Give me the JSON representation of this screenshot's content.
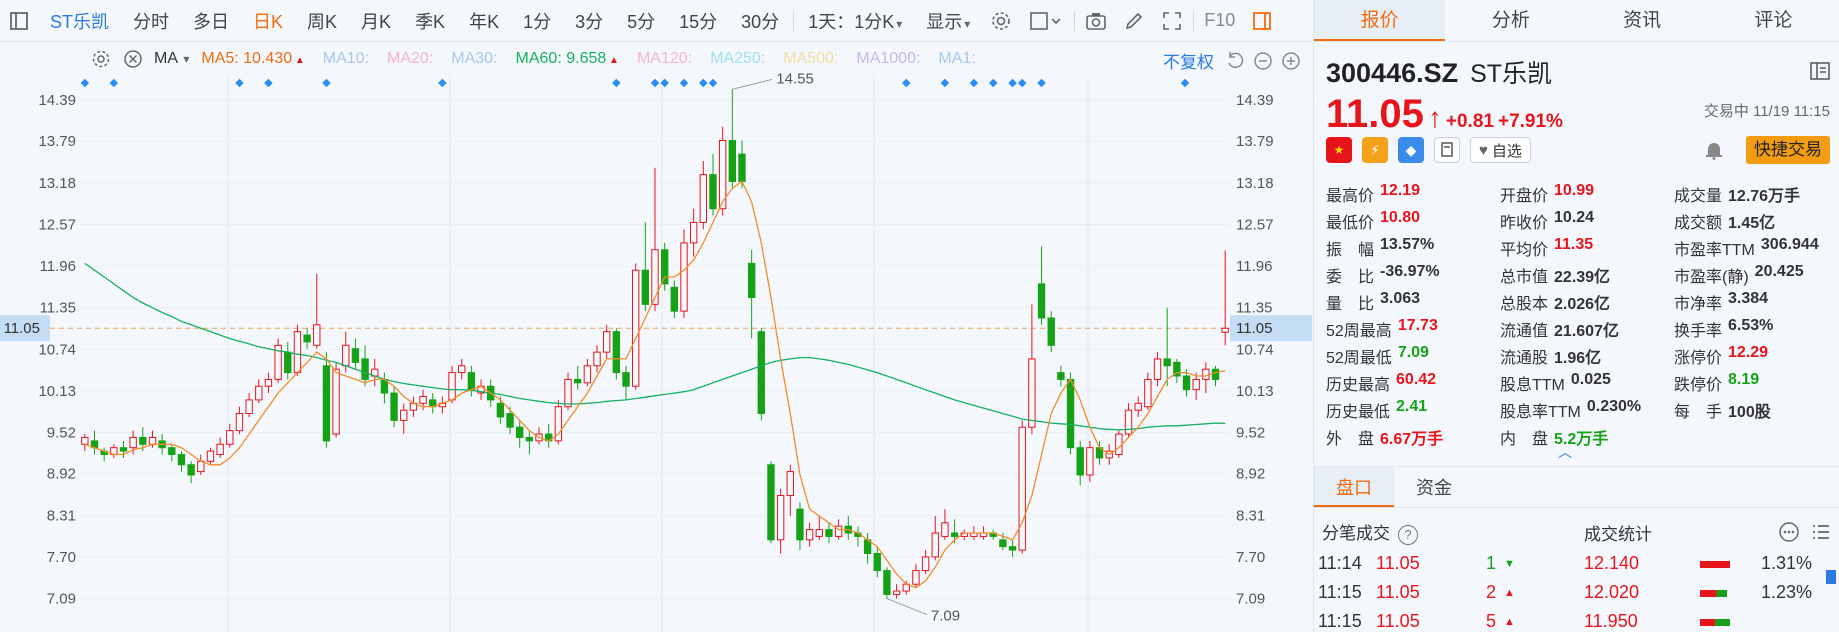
{
  "toolbar": {
    "stock_name": "ST乐凯",
    "periods": [
      "分时",
      "多日",
      "日K",
      "周K",
      "月K",
      "季K",
      "年K",
      "1分",
      "3分",
      "5分",
      "15分",
      "30分"
    ],
    "active_period": "日K",
    "interval_select": "1天：1分K",
    "display_select": "显示",
    "f10_label": "F10"
  },
  "ma_bar": {
    "indicator": "MA",
    "items": [
      {
        "label": "MA5: 10.430",
        "color": "#f26b10",
        "arrow": "up"
      },
      {
        "label": "MA10:",
        "color": "#a6c8ee"
      },
      {
        "label": "MA20:",
        "color": "#f4b6c6"
      },
      {
        "label": "MA30:",
        "color": "#a6c8ee"
      },
      {
        "label": "MA60: 9.658",
        "color": "#16b060",
        "arrow": "up"
      },
      {
        "label": "MA120:",
        "color": "#f4b6c6"
      },
      {
        "label": "MA250:",
        "color": "#9ee0ee"
      },
      {
        "label": "MA500:",
        "color": "#f3dc9e"
      },
      {
        "label": "MA1000:",
        "color": "#c6b6ee"
      },
      {
        "label": "MA1:",
        "color": "#a6c8ee"
      }
    ],
    "adjust_label": "不复权"
  },
  "chart_data": {
    "type": "candlestick",
    "y_ticks": [
      "14.39",
      "13.79",
      "13.18",
      "12.57",
      "11.96",
      "11.35",
      "10.74",
      "10.13",
      "9.52",
      "8.92",
      "8.31",
      "7.70",
      "7.09"
    ],
    "ylim": [
      6.6,
      14.95
    ],
    "current_price_label": "11.05",
    "current_price": 11.05,
    "max_label": "14.55",
    "min_label": "7.09",
    "candles": [
      [
        9.35,
        9.45,
        9.25,
        9.5
      ],
      [
        9.4,
        9.3,
        9.2,
        9.55
      ],
      [
        9.25,
        9.2,
        9.1,
        9.3
      ],
      [
        9.2,
        9.3,
        9.15,
        9.35
      ],
      [
        9.3,
        9.25,
        9.15,
        9.4
      ],
      [
        9.3,
        9.45,
        9.2,
        9.55
      ],
      [
        9.45,
        9.35,
        9.25,
        9.6
      ],
      [
        9.35,
        9.45,
        9.3,
        9.55
      ],
      [
        9.4,
        9.3,
        9.2,
        9.5
      ],
      [
        9.3,
        9.2,
        9.1,
        9.35
      ],
      [
        9.2,
        9.05,
        8.95,
        9.25
      ],
      [
        9.05,
        8.9,
        8.78,
        9.1
      ],
      [
        8.95,
        9.1,
        8.9,
        9.2
      ],
      [
        9.1,
        9.25,
        9.05,
        9.3
      ],
      [
        9.2,
        9.35,
        9.15,
        9.45
      ],
      [
        9.35,
        9.55,
        9.3,
        9.65
      ],
      [
        9.55,
        9.8,
        9.5,
        9.9
      ],
      [
        9.8,
        10.0,
        9.75,
        10.1
      ],
      [
        10.0,
        10.2,
        9.95,
        10.3
      ],
      [
        10.2,
        10.3,
        10.1,
        10.4
      ],
      [
        10.3,
        10.8,
        10.25,
        10.9
      ],
      [
        10.7,
        10.4,
        10.3,
        10.85
      ],
      [
        10.4,
        11.0,
        10.35,
        11.1
      ],
      [
        10.95,
        10.85,
        10.75,
        11.05
      ],
      [
        10.8,
        11.1,
        10.75,
        11.85
      ],
      [
        10.5,
        9.4,
        9.3,
        10.7
      ],
      [
        9.5,
        10.45,
        9.45,
        10.55
      ],
      [
        10.5,
        10.8,
        10.4,
        11.0
      ],
      [
        10.75,
        10.55,
        10.45,
        10.9
      ],
      [
        10.6,
        10.3,
        10.2,
        10.8
      ],
      [
        10.35,
        10.45,
        10.2,
        10.6
      ],
      [
        10.3,
        10.1,
        9.95,
        10.4
      ],
      [
        10.1,
        9.7,
        9.6,
        10.2
      ],
      [
        9.7,
        9.85,
        9.5,
        9.95
      ],
      [
        9.85,
        9.95,
        9.75,
        10.05
      ],
      [
        9.95,
        10.05,
        9.85,
        10.15
      ],
      [
        10.0,
        9.9,
        9.8,
        10.1
      ],
      [
        9.9,
        9.95,
        9.8,
        10.05
      ],
      [
        10.0,
        10.4,
        9.95,
        10.5
      ],
      [
        10.4,
        10.5,
        10.3,
        10.6
      ],
      [
        10.4,
        10.15,
        10.05,
        10.5
      ],
      [
        10.1,
        10.2,
        10.0,
        10.3
      ],
      [
        10.2,
        10.0,
        9.9,
        10.3
      ],
      [
        9.95,
        9.75,
        9.65,
        10.05
      ],
      [
        9.8,
        9.6,
        9.5,
        9.9
      ],
      [
        9.6,
        9.45,
        9.3,
        9.7
      ],
      [
        9.45,
        9.4,
        9.2,
        9.55
      ],
      [
        9.4,
        9.5,
        9.35,
        9.6
      ],
      [
        9.5,
        9.4,
        9.3,
        9.65
      ],
      [
        9.4,
        9.9,
        9.35,
        10.0
      ],
      [
        9.9,
        10.3,
        9.85,
        10.4
      ],
      [
        10.3,
        10.25,
        10.15,
        10.5
      ],
      [
        10.25,
        10.5,
        10.2,
        10.6
      ],
      [
        10.5,
        10.7,
        10.4,
        10.8
      ],
      [
        10.7,
        11.0,
        10.6,
        11.1
      ],
      [
        11.0,
        10.4,
        10.3,
        11.05
      ],
      [
        10.4,
        10.2,
        10.0,
        10.5
      ],
      [
        10.2,
        11.9,
        10.15,
        12.0
      ],
      [
        11.9,
        11.4,
        11.3,
        12.6
      ],
      [
        11.4,
        12.2,
        11.3,
        13.4
      ],
      [
        12.2,
        11.7,
        11.6,
        12.3
      ],
      [
        11.65,
        11.3,
        11.2,
        11.75
      ],
      [
        11.3,
        12.3,
        11.2,
        12.5
      ],
      [
        12.3,
        12.6,
        12.1,
        12.8
      ],
      [
        12.6,
        13.3,
        12.5,
        13.5
      ],
      [
        13.3,
        12.8,
        12.7,
        13.6
      ],
      [
        12.8,
        13.8,
        12.7,
        14.0
      ],
      [
        13.8,
        13.2,
        13.1,
        14.55
      ],
      [
        13.6,
        13.2,
        13.1,
        13.8
      ],
      [
        12.0,
        11.5,
        10.9,
        12.2
      ],
      [
        11.0,
        9.8,
        9.7,
        11.05
      ],
      [
        9.05,
        7.95,
        7.9,
        9.1
      ],
      [
        7.95,
        8.6,
        7.75,
        8.7
      ],
      [
        8.6,
        8.95,
        8.3,
        9.05
      ],
      [
        8.4,
        7.95,
        7.8,
        8.5
      ],
      [
        7.95,
        8.1,
        7.85,
        8.2
      ],
      [
        8.0,
        8.1,
        7.95,
        8.3
      ],
      [
        8.1,
        8.0,
        7.9,
        8.2
      ],
      [
        8.0,
        8.15,
        7.95,
        8.25
      ],
      [
        8.15,
        8.05,
        7.95,
        8.3
      ],
      [
        8.05,
        8.0,
        7.85,
        8.15
      ],
      [
        7.95,
        7.75,
        7.6,
        8.05
      ],
      [
        7.75,
        7.5,
        7.4,
        7.85
      ],
      [
        7.5,
        7.15,
        7.09,
        7.55
      ],
      [
        7.15,
        7.2,
        7.09,
        7.3
      ],
      [
        7.2,
        7.3,
        7.15,
        7.35
      ],
      [
        7.3,
        7.5,
        7.25,
        7.6
      ],
      [
        7.5,
        7.7,
        7.45,
        7.8
      ],
      [
        7.7,
        8.05,
        7.65,
        8.3
      ],
      [
        8.0,
        8.2,
        7.95,
        8.4
      ],
      [
        8.05,
        8.0,
        7.9,
        8.25
      ],
      [
        8.0,
        8.05,
        7.95,
        8.1
      ],
      [
        8.0,
        8.05,
        7.95,
        8.15
      ],
      [
        8.0,
        8.05,
        7.95,
        8.15
      ],
      [
        8.05,
        8.0,
        7.95,
        8.1
      ],
      [
        7.95,
        7.85,
        7.8,
        8.05
      ],
      [
        7.85,
        7.8,
        7.7,
        7.95
      ],
      [
        7.8,
        9.6,
        7.75,
        9.7
      ],
      [
        9.6,
        10.6,
        9.5,
        11.4
      ],
      [
        11.7,
        11.2,
        11.1,
        12.25
      ],
      [
        11.2,
        10.8,
        10.7,
        11.3
      ],
      [
        10.4,
        10.3,
        10.2,
        10.5
      ],
      [
        10.3,
        9.3,
        9.2,
        10.4
      ],
      [
        9.3,
        8.9,
        8.75,
        9.4
      ],
      [
        8.9,
        9.3,
        8.8,
        9.4
      ],
      [
        9.3,
        9.15,
        9.05,
        9.4
      ],
      [
        9.15,
        9.25,
        9.05,
        9.35
      ],
      [
        9.2,
        9.5,
        9.15,
        9.55
      ],
      [
        9.5,
        9.85,
        9.45,
        9.95
      ],
      [
        9.85,
        9.95,
        9.75,
        10.05
      ],
      [
        9.9,
        10.3,
        9.85,
        10.4
      ],
      [
        10.3,
        10.6,
        10.2,
        10.7
      ],
      [
        10.6,
        10.5,
        10.2,
        11.35
      ],
      [
        10.55,
        10.35,
        10.25,
        10.6
      ],
      [
        10.35,
        10.15,
        10.05,
        10.45
      ],
      [
        10.15,
        10.3,
        10.0,
        10.4
      ],
      [
        10.3,
        10.45,
        10.1,
        10.55
      ],
      [
        10.45,
        10.3,
        10.2,
        10.5
      ],
      [
        10.99,
        11.05,
        10.8,
        12.19
      ]
    ],
    "ma5": [
      9.35,
      9.3,
      9.25,
      9.2,
      9.2,
      9.27,
      9.3,
      9.35,
      9.35,
      9.35,
      9.3,
      9.2,
      9.1,
      9.05,
      9.05,
      9.15,
      9.3,
      9.5,
      9.7,
      9.9,
      10.1,
      10.25,
      10.4,
      10.55,
      10.7,
      10.6,
      10.4,
      10.35,
      10.3,
      10.25,
      10.3,
      10.3,
      10.2,
      10.05,
      9.95,
      9.9,
      9.9,
      9.95,
      10.0,
      10.1,
      10.15,
      10.2,
      10.1,
      10.0,
      9.85,
      9.7,
      9.55,
      9.45,
      9.4,
      9.5,
      9.7,
      9.9,
      10.1,
      10.35,
      10.6,
      10.6,
      10.6,
      10.9,
      11.2,
      11.5,
      11.8,
      11.8,
      11.9,
      12.05,
      12.3,
      12.6,
      12.9,
      13.1,
      13.2,
      12.9,
      12.3,
      11.5,
      10.6,
      9.8,
      8.9,
      8.4,
      8.3,
      8.2,
      8.1,
      8.1,
      8.05,
      7.95,
      7.85,
      7.65,
      7.45,
      7.3,
      7.25,
      7.35,
      7.55,
      7.8,
      7.95,
      8.05,
      8.05,
      8.05,
      8.05,
      8.0,
      7.95,
      8.2,
      8.6,
      9.2,
      9.8,
      10.1,
      10.3,
      10.0,
      9.6,
      9.3,
      9.2,
      9.3,
      9.45,
      9.6,
      9.8,
      10.05,
      10.3,
      10.4,
      10.4,
      10.35,
      10.35,
      10.4,
      10.43
    ],
    "ma60": [
      12.0,
      11.9,
      11.8,
      11.7,
      11.6,
      11.5,
      11.42,
      11.35,
      11.28,
      11.22,
      11.15,
      11.1,
      11.05,
      11.0,
      10.95,
      10.9,
      10.86,
      10.82,
      10.78,
      10.75,
      10.72,
      10.7,
      10.67,
      10.65,
      10.62,
      10.58,
      10.55,
      10.5,
      10.45,
      10.4,
      10.35,
      10.3,
      10.27,
      10.24,
      10.22,
      10.2,
      10.18,
      10.16,
      10.15,
      10.15,
      10.14,
      10.12,
      10.1,
      10.08,
      10.05,
      10.02,
      10.0,
      9.98,
      9.96,
      9.95,
      9.94,
      9.94,
      9.95,
      9.96,
      9.98,
      9.99,
      10.0,
      10.02,
      10.04,
      10.06,
      10.08,
      10.1,
      10.12,
      10.15,
      10.2,
      10.25,
      10.3,
      10.35,
      10.4,
      10.45,
      10.5,
      10.55,
      10.58,
      10.6,
      10.62,
      10.62,
      10.6,
      10.58,
      10.55,
      10.52,
      10.48,
      10.44,
      10.4,
      10.35,
      10.3,
      10.25,
      10.2,
      10.15,
      10.1,
      10.05,
      10.0,
      9.96,
      9.92,
      9.88,
      9.84,
      9.8,
      9.76,
      9.72,
      9.7,
      9.68,
      9.66,
      9.65,
      9.64,
      9.62,
      9.6,
      9.58,
      9.57,
      9.56,
      9.57,
      9.58,
      9.6,
      9.61,
      9.62,
      9.62,
      9.63,
      9.64,
      9.65,
      9.66,
      9.658
    ]
  },
  "right_panel": {
    "tabs": [
      "报价",
      "分析",
      "资讯",
      "评论"
    ],
    "active_tab": "报价",
    "code": "300446.SZ",
    "name": "ST乐凯",
    "price": "11.05",
    "change": "+0.81",
    "change_pct": "+7.91%",
    "trade_status": "交易中 11/19 11:15",
    "fav_label": "自选",
    "quick_trade_label": "快捷交易",
    "stats": [
      [
        {
          "label": "最高价",
          "value": "12.19",
          "c": "red"
        },
        {
          "label": "开盘价",
          "value": "10.99",
          "c": "red"
        },
        {
          "label": "成交量",
          "value": "12.76万手",
          "c": ""
        }
      ],
      [
        {
          "label": "最低价",
          "value": "10.80",
          "c": "red"
        },
        {
          "label": "昨收价",
          "value": "10.24",
          "c": ""
        },
        {
          "label": "成交额",
          "value": "1.45亿",
          "c": ""
        }
      ],
      [
        {
          "label": "振　幅",
          "value": "13.57%",
          "c": ""
        },
        {
          "label": "平均价",
          "value": "11.35",
          "c": "red"
        },
        {
          "label": "市盈率TTM",
          "value": "306.944",
          "c": ""
        }
      ],
      [
        {
          "label": "委　比",
          "value": "-36.97%",
          "c": ""
        },
        {
          "label": "总市值",
          "value": "22.39亿",
          "c": ""
        },
        {
          "label": "市盈率(静)",
          "value": "20.425",
          "c": ""
        }
      ],
      [
        {
          "label": "量　比",
          "value": "3.063",
          "c": ""
        },
        {
          "label": "总股本",
          "value": "2.026亿",
          "c": ""
        },
        {
          "label": "市净率",
          "value": "3.384",
          "c": ""
        }
      ],
      [
        {
          "label": "52周最高",
          "value": "17.73",
          "c": "red"
        },
        {
          "label": "流通值",
          "value": "21.607亿",
          "c": ""
        },
        {
          "label": "换手率",
          "value": "6.53%",
          "c": ""
        }
      ],
      [
        {
          "label": "52周最低",
          "value": "7.09",
          "c": "green"
        },
        {
          "label": "流通股",
          "value": "1.96亿",
          "c": ""
        },
        {
          "label": "涨停价",
          "value": "12.29",
          "c": "red"
        }
      ],
      [
        {
          "label": "历史最高",
          "value": "60.42",
          "c": "red"
        },
        {
          "label": "股息TTM",
          "value": "0.025",
          "c": ""
        },
        {
          "label": "跌停价",
          "value": "8.19",
          "c": "green"
        }
      ],
      [
        {
          "label": "历史最低",
          "value": "2.41",
          "c": "green"
        },
        {
          "label": "股息率TTM",
          "value": "0.230%",
          "c": ""
        },
        {
          "label": "每　手",
          "value": "100股",
          "c": ""
        }
      ],
      [
        {
          "label": "外　盘",
          "value": "6.67万手",
          "c": "red"
        },
        {
          "label": "内　盘",
          "value": "5.2万手",
          "c": "green"
        },
        {
          "label": "",
          "value": "",
          "c": ""
        }
      ]
    ],
    "sub_tabs": [
      "盘口",
      "资金"
    ],
    "active_sub_tab": "盘口",
    "ticks_title": "分笔成交",
    "stats_title": "成交统计",
    "ticks": [
      {
        "time": "11:14",
        "price": "11.05",
        "vol": "1",
        "dir": "down"
      },
      {
        "time": "11:15",
        "price": "11.05",
        "vol": "2",
        "dir": "up"
      },
      {
        "time": "11:15",
        "price": "11.05",
        "vol": "5",
        "dir": "up"
      }
    ],
    "deal_stats": [
      {
        "price": "12.140",
        "pct": "1.31%",
        "red": 1.0,
        "green": 0.0
      },
      {
        "price": "12.020",
        "pct": "1.23%",
        "red": 0.55,
        "green": 0.35
      },
      {
        "price": "11.950",
        "pct": "",
        "red": 0.5,
        "green": 0.5
      }
    ]
  }
}
